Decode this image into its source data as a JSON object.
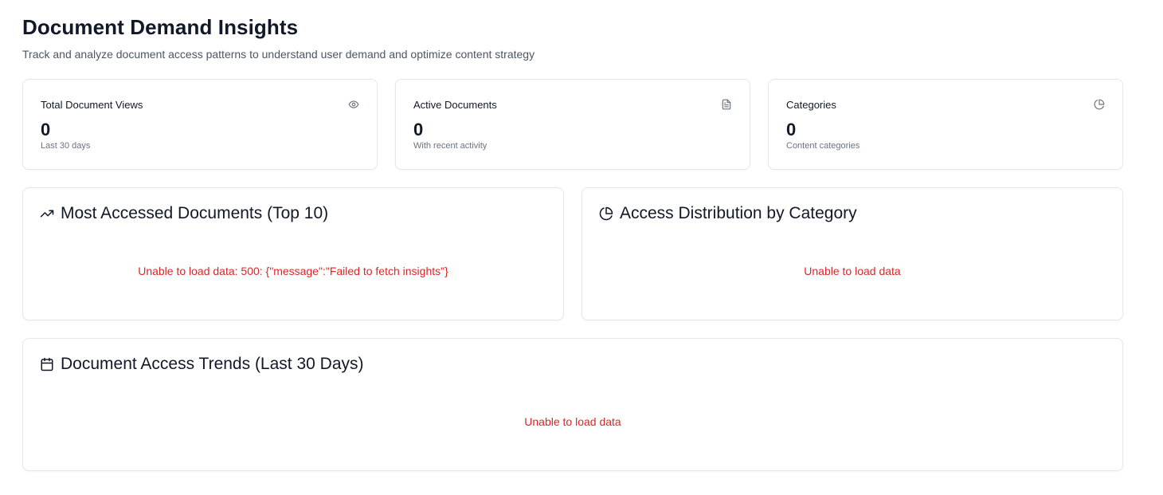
{
  "header": {
    "title": "Document Demand Insights",
    "subtitle": "Track and analyze document access patterns to understand user demand and optimize content strategy"
  },
  "stats": [
    {
      "label": "Total Document Views",
      "value": "0",
      "caption": "Last 30 days",
      "icon": "eye-icon"
    },
    {
      "label": "Active Documents",
      "value": "0",
      "caption": "With recent activity",
      "icon": "file-text-icon"
    },
    {
      "label": "Categories",
      "value": "0",
      "caption": "Content categories",
      "icon": "pie-chart-icon"
    }
  ],
  "panels": {
    "most_accessed": {
      "title": "Most Accessed Documents (Top 10)",
      "icon": "trending-up-icon",
      "error": "Unable to load data: 500: {\"message\":\"Failed to fetch insights\"}"
    },
    "distribution": {
      "title": "Access Distribution by Category",
      "icon": "pie-chart-icon",
      "error": "Unable to load data"
    },
    "trends": {
      "title": "Document Access Trends (Last 30 Days)",
      "icon": "calendar-icon",
      "error": "Unable to load data"
    }
  },
  "colors": {
    "error": "#dc2626",
    "border": "#e5e7eb",
    "muted": "#6b7280",
    "text": "#111827"
  }
}
